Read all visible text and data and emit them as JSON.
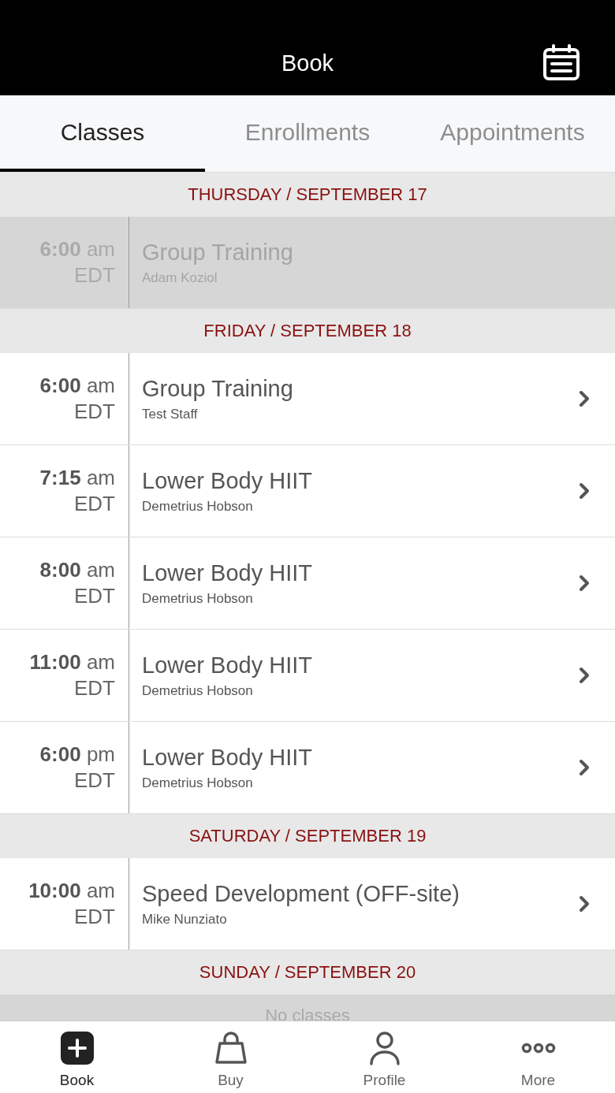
{
  "header": {
    "title": "Book"
  },
  "tabs": [
    {
      "label": "Classes",
      "selected": true
    },
    {
      "label": "Enrollments",
      "selected": false
    },
    {
      "label": "Appointments",
      "selected": false
    }
  ],
  "days": [
    {
      "heading": "THURSDAY / SEPTEMBER 17",
      "classes": [
        {
          "time": "6:00",
          "meridiem": "am",
          "zone": "EDT",
          "name": "Group Training",
          "staff": "Adam Koziol",
          "past": true
        }
      ]
    },
    {
      "heading": "FRIDAY / SEPTEMBER 18",
      "classes": [
        {
          "time": "6:00",
          "meridiem": "am",
          "zone": "EDT",
          "name": "Group Training",
          "staff": "Test Staff",
          "past": false
        },
        {
          "time": "7:15",
          "meridiem": "am",
          "zone": "EDT",
          "name": "Lower Body HIIT",
          "staff": "Demetrius Hobson",
          "past": false
        },
        {
          "time": "8:00",
          "meridiem": "am",
          "zone": "EDT",
          "name": "Lower Body HIIT",
          "staff": "Demetrius Hobson",
          "past": false
        },
        {
          "time": "11:00",
          "meridiem": "am",
          "zone": "EDT",
          "name": "Lower Body HIIT",
          "staff": "Demetrius Hobson",
          "past": false
        },
        {
          "time": "6:00",
          "meridiem": "pm",
          "zone": "EDT",
          "name": "Lower Body HIIT",
          "staff": "Demetrius Hobson",
          "past": false
        }
      ]
    },
    {
      "heading": "SATURDAY / SEPTEMBER 19",
      "classes": [
        {
          "time": "10:00",
          "meridiem": "am",
          "zone": "EDT",
          "name": "Speed Development (OFF-site)",
          "staff": "Mike Nunziato",
          "past": false
        }
      ]
    },
    {
      "heading": "SUNDAY / SEPTEMBER 20",
      "empty_text": "No classes"
    }
  ],
  "bottom_nav": [
    {
      "kind": "book",
      "label": "Book",
      "selected": true
    },
    {
      "kind": "buy",
      "label": "Buy",
      "selected": false
    },
    {
      "kind": "profile",
      "label": "Profile",
      "selected": false
    },
    {
      "kind": "more",
      "label": "More",
      "selected": false
    }
  ]
}
